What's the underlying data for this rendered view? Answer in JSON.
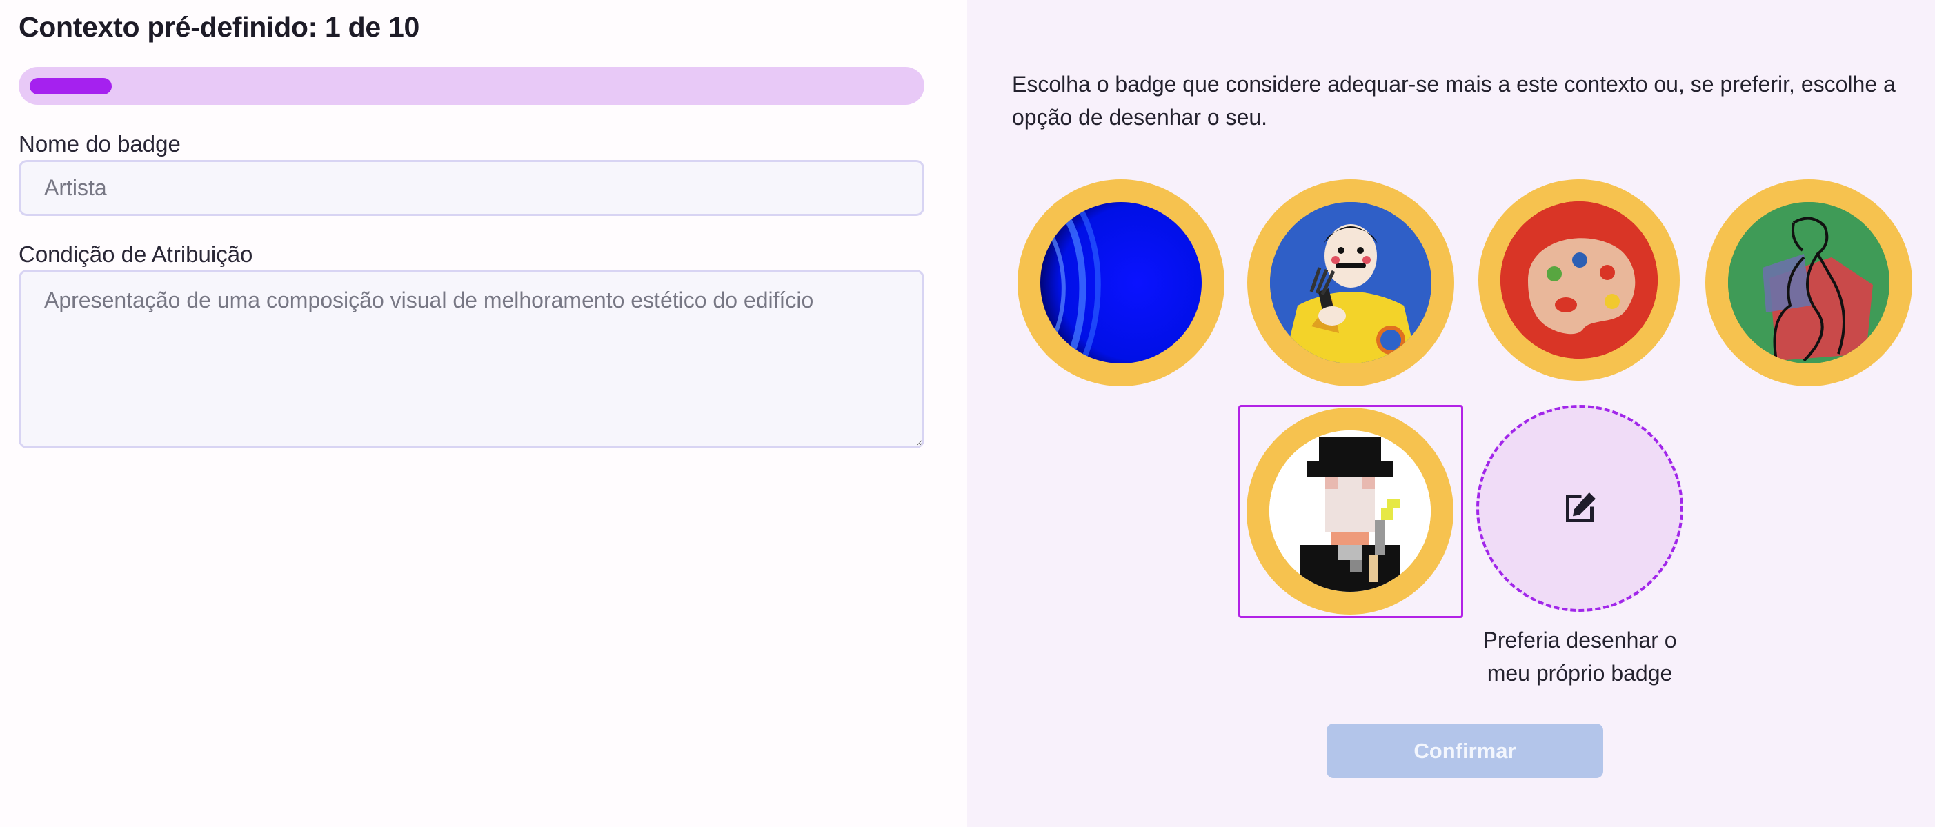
{
  "header": {
    "title": "Contexto pré-definido: 1 de 10"
  },
  "progress": {
    "current": 1,
    "total": 10,
    "fraction": 0.1
  },
  "form": {
    "badge_name": {
      "label": "Nome do badge",
      "placeholder": "Artista"
    },
    "condition": {
      "label": "Condição de Atribuição",
      "placeholder": "Apresentação de uma composição visual de melhoramento estético do edifício"
    }
  },
  "selection": {
    "instructions": "Escolha o badge que considere adequar-se mais a este contexto ou, se preferir, escolhe a opção de desenhar o seu.",
    "badges": [
      {
        "icon": "blue-swirl-icon",
        "selected": false
      },
      {
        "icon": "painter-portrait-icon",
        "selected": false
      },
      {
        "icon": "paint-palette-icon",
        "selected": false
      },
      {
        "icon": "line-figure-icon",
        "selected": false
      },
      {
        "icon": "pixel-top-hat-man-icon",
        "selected": true
      }
    ],
    "draw_own_label": "Preferia desenhar o meu próprio badge",
    "confirm_label": "Confirmar"
  },
  "colors": {
    "accent": "#a521ef",
    "progress_track": "#e8c9f7",
    "badge_ring": "#f6c24f",
    "confirm_disabled": "#b3c5ea",
    "right_panel_bg": "#f8f1fb"
  }
}
